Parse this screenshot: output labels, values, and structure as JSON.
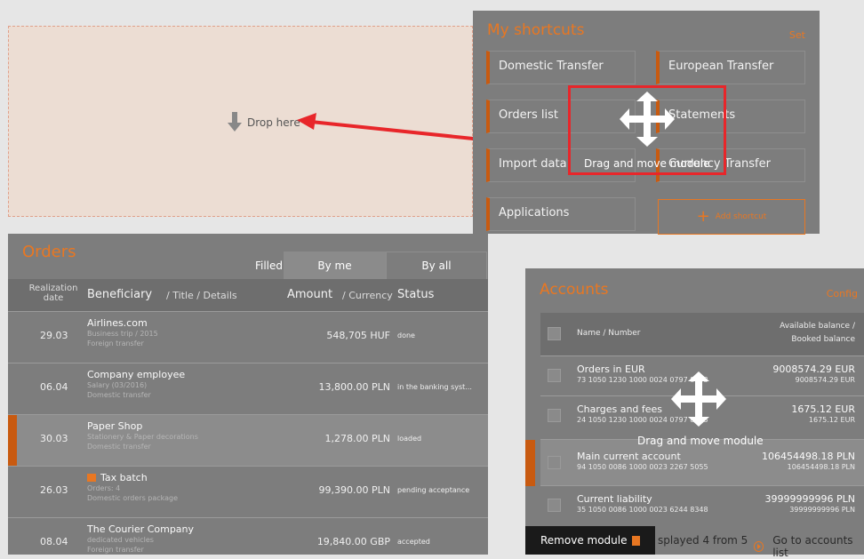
{
  "drop": {
    "label": "Drop here"
  },
  "shortcuts": {
    "title": "My shortcuts",
    "set": "Set",
    "items": [
      "Domestic Transfer",
      "European Transfer",
      "Orders list",
      "Statements",
      "Import data",
      "Currency Transfer",
      "Applications"
    ],
    "add": "Add shortcut"
  },
  "move_overlay_1": {
    "label": "Drag and move module"
  },
  "orders": {
    "title": "Orders",
    "tabs": [
      "Filled",
      "By me",
      "By all"
    ],
    "head": {
      "date": "Realization date",
      "beneficiary": "Beneficiary",
      "beneficiary_sub": "/ Title / Details",
      "amount": "Amount",
      "amount_sub": "/ Currency",
      "status": "Status"
    },
    "rows": [
      {
        "date": "29.03",
        "name": "Airlines.com",
        "title": "Business trip / 2015",
        "detail": "Foreign transfer",
        "amount": "548,705 HUF",
        "status": "done"
      },
      {
        "date": "06.04",
        "name": "Company employee",
        "title": "Salary (03/2016)",
        "detail": "Domestic transfer",
        "amount": "13,800.00 PLN",
        "status": "in the banking syst..."
      },
      {
        "date": "30.03",
        "name": "Paper Shop",
        "title": "Stationery & Paper decorations",
        "detail": "Domestic transfer",
        "amount": "1,278.00 PLN",
        "status": "loaded"
      },
      {
        "date": "26.03",
        "name": "Tax batch",
        "title": "Orders: 4",
        "detail": "Domestic orders package",
        "amount": "99,390.00 PLN",
        "status": "pending acceptance"
      },
      {
        "date": "08.04",
        "name": "The Courier Company",
        "title": "dedicated vehicles",
        "detail": "Foreign transfer",
        "amount": "19,840.00 GBP",
        "status": "accepted"
      }
    ]
  },
  "accounts": {
    "title": "Accounts",
    "config": "Config",
    "head": {
      "name": "Name / Number",
      "balance1": "Available balance /",
      "balance2": "Booked balance"
    },
    "rows": [
      {
        "name": "Orders in EUR",
        "number": "73 1050 1230 1000 0024 0797 8493",
        "available": "9008574.29 EUR",
        "booked": "9008574.29 EUR"
      },
      {
        "name": "Charges and fees",
        "number": "24 1050 1230 1000 0024 0797 8133",
        "available": "1675.12 EUR",
        "booked": "1675.12 EUR"
      },
      {
        "name": "Main current account",
        "number": "94 1050 0086 1000 0023 2267 5055",
        "available": "106454498.18 PLN",
        "booked": "106454498.18 PLN"
      },
      {
        "name": "Current liability",
        "number": "35 1050 0086 1000 0023 6244 8348",
        "available": "39999999996 PLN",
        "booked": "39999999996 PLN"
      }
    ],
    "remove": "Remove module",
    "displayed": "splayed 4 from 5",
    "goto": "Go to accounts list"
  },
  "move_overlay_2": {
    "label": "Drag and move module"
  }
}
